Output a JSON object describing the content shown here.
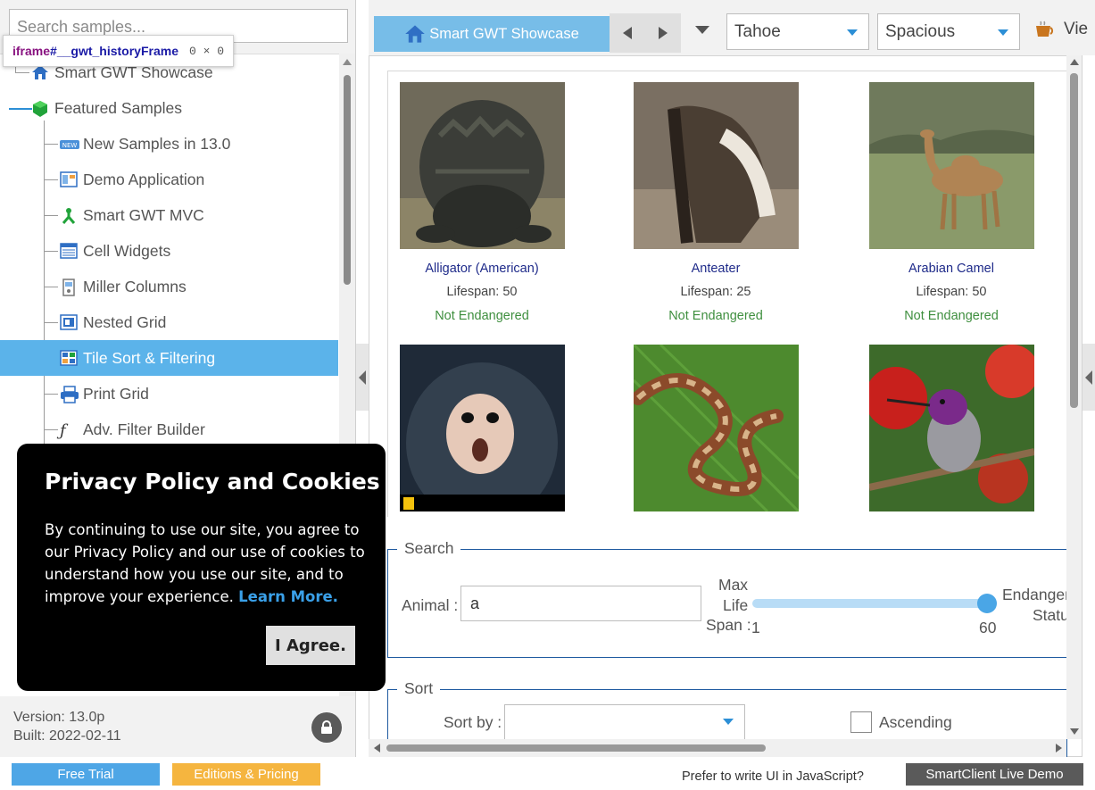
{
  "sidebar": {
    "search_placeholder": "Search samples...",
    "tooltip": {
      "tag": "iframe",
      "id": "#__gwt_historyFrame",
      "size": "0 × 0"
    },
    "tree": [
      {
        "label": "Smart GWT Showcase",
        "icon": "home-icon"
      },
      {
        "label": "Featured Samples",
        "icon": "cube-icon"
      },
      {
        "label": "New Samples in 13.0",
        "icon": "new-badge-icon"
      },
      {
        "label": "Demo Application",
        "icon": "app-window-icon"
      },
      {
        "label": "Smart GWT MVC",
        "icon": "mvc-icon"
      },
      {
        "label": "Cell Widgets",
        "icon": "list-icon"
      },
      {
        "label": "Miller Columns",
        "icon": "columns-icon"
      },
      {
        "label": "Nested Grid",
        "icon": "grid-icon"
      },
      {
        "label": "Tile Sort & Filtering",
        "icon": "tiles-icon",
        "selected": true
      },
      {
        "label": "Print Grid",
        "icon": "printer-icon"
      },
      {
        "label": "Adv. Filter Builder",
        "icon": "function-icon"
      }
    ],
    "version": "Version: 13.0p",
    "built": "Built: 2022-02-11"
  },
  "toolbar": {
    "home_tab": "Smart GWT Showcase",
    "skin_select": "Tahoe",
    "density_select": "Spacious",
    "view_label": "Vie"
  },
  "tiles": [
    {
      "name": "Alligator (American)",
      "lifespan": "Lifespan: 50",
      "status": "Not Endangered",
      "photo": "alligator-photo"
    },
    {
      "name": "Anteater",
      "lifespan": "Lifespan: 25",
      "status": "Not Endangered",
      "photo": "anteater-photo"
    },
    {
      "name": "Arabian Camel",
      "lifespan": "Lifespan: 50",
      "status": "Not Endangered",
      "photo": "camel-photo"
    },
    {
      "name": "",
      "lifespan": "",
      "status": "",
      "photo": "monkey-photo"
    },
    {
      "name": "",
      "lifespan": "",
      "status": "",
      "photo": "boa-snake-photo"
    },
    {
      "name": "",
      "lifespan": "",
      "status": "",
      "photo": "hummingbird-photo"
    }
  ],
  "search_form": {
    "legend": "Search",
    "animal_label": "Animal :",
    "animal_value": "a",
    "max_label_1": "Max",
    "max_label_2": "Life",
    "max_label_3": "Span :",
    "slider_min": "1",
    "slider_max": "60",
    "slider_value": 60,
    "endangered_label_1": "Endanger",
    "endangered_label_2": "Statu"
  },
  "sort_form": {
    "legend": "Sort",
    "sort_by_label": "Sort by :",
    "sort_by_value": "",
    "ascending_label": "Ascending"
  },
  "cookie_dialog": {
    "title": "Privacy Policy and Cookies",
    "body": "By continuing to use our site, you agree to our Privacy Policy and our use of cookies to understand how you use our site, and to improve your experience.",
    "link": "Learn More.",
    "agree": "I Agree."
  },
  "bottom": {
    "free_trial": "Free Trial",
    "editions": "Editions & Pricing",
    "prefer_text": "Prefer to write UI in JavaScript?",
    "live_demo": "SmartClient Live Demo"
  },
  "colors": {
    "accent_blue": "#5bb3ea",
    "free_trial_bg": "#4ea6e6",
    "editions_bg": "#f5b53f",
    "live_demo_bg": "#5a5a5a",
    "status_green": "#3f8f3f",
    "name_blue": "#1f2b8a"
  }
}
